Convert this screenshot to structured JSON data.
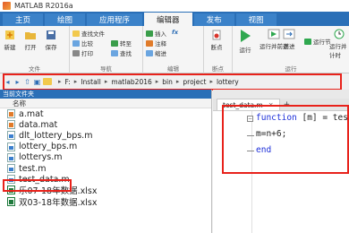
{
  "app": {
    "title": "MATLAB R2016a"
  },
  "tabs": [
    "主页",
    "绘图",
    "应用程序",
    "编辑器",
    "发布",
    "视图"
  ],
  "active_tab": "编辑器",
  "ribbon": {
    "file_group": {
      "title": "文件",
      "new": "新建",
      "open": "打开",
      "save": "保存"
    },
    "nav_group": {
      "title": "导航",
      "compare": "比较",
      "print": "打印",
      "find_file": "查找文件",
      "goto": "转至",
      "find": "查找"
    },
    "edit_group": {
      "title": "编辑",
      "insert": "插入",
      "comment": "注释",
      "indent": "缩进"
    },
    "breakpoint_group": {
      "title": "断点",
      "breakpoint": "断点"
    },
    "run_group": {
      "title": "运行",
      "run": "运行",
      "run_advance": "运行并前进",
      "advance": "前进",
      "run_section": "运行节",
      "run_time": "运行并计时"
    }
  },
  "address": {
    "crumbs": [
      "F:",
      "Install",
      "matlab2016",
      "bin",
      "project",
      "lottery"
    ]
  },
  "file_browser": {
    "header": "当前文件夹",
    "column": "名称",
    "files": [
      {
        "name": "a.mat",
        "type": "mat"
      },
      {
        "name": "data.mat",
        "type": "mat"
      },
      {
        "name": "dlt_lottery_bps.m",
        "type": "m"
      },
      {
        "name": "lottery_bps.m",
        "type": "m"
      },
      {
        "name": "lotterys.m",
        "type": "m"
      },
      {
        "name": "test.m",
        "type": "m"
      },
      {
        "name": "test_data.m",
        "type": "m"
      },
      {
        "name": "乐07-18年数据.xlsx",
        "type": "xls"
      },
      {
        "name": "双03-18年数据.xlsx",
        "type": "xls"
      }
    ],
    "selected": "test_data.m"
  },
  "editor": {
    "tab_label": "test_data.m",
    "close": "×",
    "plus": "+",
    "lines": [
      {
        "kw": "function",
        "rest": " [m] = tes"
      },
      {
        "kw": "",
        "rest": "m=n+6;"
      },
      {
        "kw": "end",
        "rest": ""
      }
    ]
  },
  "colors": {
    "accent": "#2a6fb7",
    "highlight_box": "#e8221b",
    "keyword": "#1d2fd9"
  }
}
